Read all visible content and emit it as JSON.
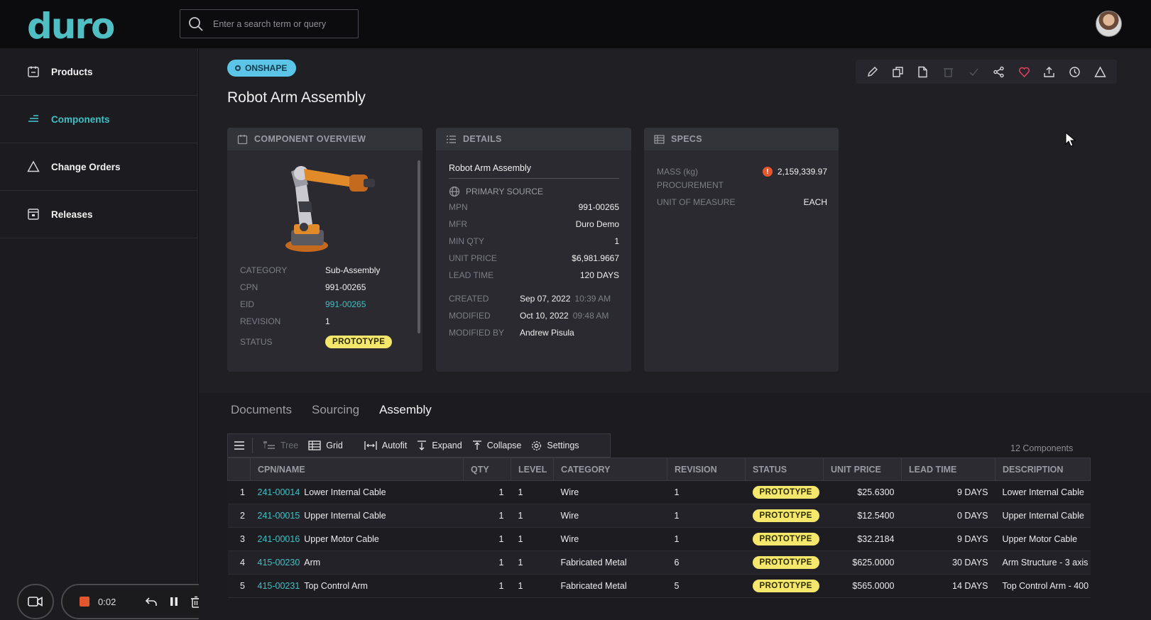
{
  "app": {
    "logo": "duro",
    "search_placeholder": "Enter a search term or query"
  },
  "sidebar": {
    "items": [
      {
        "label": "Products",
        "icon": "products-icon"
      },
      {
        "label": "Components",
        "icon": "components-icon",
        "active": true
      },
      {
        "label": "Change Orders",
        "icon": "triangle-icon"
      },
      {
        "label": "Releases",
        "icon": "releases-icon"
      }
    ]
  },
  "recorder": {
    "time": "0:02"
  },
  "header": {
    "badge": "ONSHAPE",
    "title": "Robot Arm Assembly"
  },
  "overview": {
    "header": "COMPONENT OVERVIEW",
    "fields": [
      {
        "label": "CATEGORY",
        "value": "Sub-Assembly"
      },
      {
        "label": "CPN",
        "value": "991-00265"
      },
      {
        "label": "EID",
        "value": "991-00265"
      },
      {
        "label": "REVISION",
        "value": "1"
      },
      {
        "label": "STATUS",
        "value": "PROTOTYPE"
      }
    ]
  },
  "details": {
    "header": "DETAILS",
    "name": "Robot Arm Assembly",
    "primary_source_label": "PRIMARY SOURCE",
    "fields": [
      {
        "label": "MPN",
        "value": "991-00265"
      },
      {
        "label": "MFR",
        "value": "Duro Demo"
      },
      {
        "label": "MIN QTY",
        "value": "1"
      },
      {
        "label": "UNIT PRICE",
        "value": "$6,981.9667"
      },
      {
        "label": "LEAD TIME",
        "value": "120 DAYS"
      }
    ],
    "created_label": "CREATED",
    "created_date": "Sep 07, 2022",
    "created_time": "10:39 AM",
    "modified_label": "MODIFIED",
    "modified_date": "Oct 10, 2022",
    "modified_time": "09:48 AM",
    "modified_by_label": "MODIFIED BY",
    "modified_by": "Andrew Pisula"
  },
  "specs": {
    "header": "SPECS",
    "mass_label": "MASS (kg)",
    "mass_value": "2,159,339.97",
    "procurement_label": "PROCUREMENT",
    "uom_label": "UNIT OF MEASURE",
    "uom_value": "EACH"
  },
  "tabs": [
    {
      "label": "Documents"
    },
    {
      "label": "Sourcing"
    },
    {
      "label": "Assembly",
      "active": true
    }
  ],
  "grid_toolbar": {
    "tree": "Tree",
    "grid": "Grid",
    "autofit": "Autofit",
    "expand": "Expand",
    "collapse": "Collapse",
    "settings": "Settings",
    "count": "12 Components"
  },
  "table": {
    "columns": [
      "CPN/NAME",
      "QTY",
      "LEVEL",
      "CATEGORY",
      "REVISION",
      "STATUS",
      "UNIT PRICE",
      "LEAD TIME",
      "DESCRIPTION"
    ],
    "rows": [
      {
        "idx": "1",
        "cpn": "241-00014",
        "name": "Lower Internal Cable",
        "qty": "1",
        "level": "1",
        "category": "Wire",
        "revision": "1",
        "status": "PROTOTYPE",
        "price": "$25.6300",
        "lead": "9 DAYS",
        "desc": "Lower Internal Cable"
      },
      {
        "idx": "2",
        "cpn": "241-00015",
        "name": "Upper Internal Cable",
        "qty": "1",
        "level": "1",
        "category": "Wire",
        "revision": "1",
        "status": "PROTOTYPE",
        "price": "$12.5400",
        "lead": "0 DAYS",
        "desc": "Upper Internal Cable"
      },
      {
        "idx": "3",
        "cpn": "241-00016",
        "name": "Upper Motor Cable",
        "qty": "1",
        "level": "1",
        "category": "Wire",
        "revision": "1",
        "status": "PROTOTYPE",
        "price": "$32.2184",
        "lead": "9 DAYS",
        "desc": "Upper Motor Cable"
      },
      {
        "idx": "4",
        "cpn": "415-00230",
        "name": "Arm",
        "qty": "1",
        "level": "1",
        "category": "Fabricated Metal",
        "revision": "6",
        "status": "PROTOTYPE",
        "price": "$625.0000",
        "lead": "30 DAYS",
        "desc": "Arm Structure - 3 axis"
      },
      {
        "idx": "5",
        "cpn": "415-00231",
        "name": "Top Control Arm",
        "qty": "1",
        "level": "1",
        "category": "Fabricated Metal",
        "revision": "5",
        "status": "PROTOTYPE",
        "price": "$565.0000",
        "lead": "14 DAYS",
        "desc": "Top Control Arm - 400"
      }
    ]
  },
  "colors": {
    "accent": "#3fc0c4",
    "prototype": "#f4e76b",
    "onshape": "#5cc4e6",
    "warning": "#e4572e"
  }
}
